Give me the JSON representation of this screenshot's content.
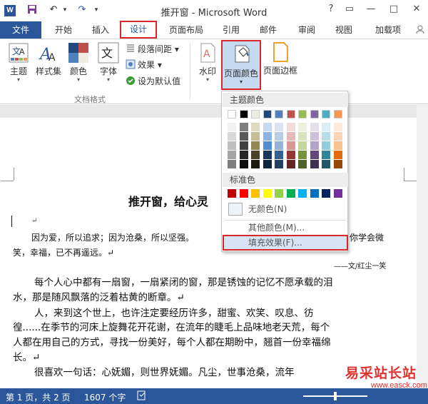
{
  "window": {
    "title": "推开窗 - Microsoft Word",
    "help": "?",
    "minimize": "—",
    "restore": "□",
    "close": "✕",
    "ribbon_toggle": "▭"
  },
  "quick_access": {
    "app_icon": "W",
    "save": "💾",
    "undo": "↶",
    "undo_drop": "▾",
    "redo": "↷",
    "customize": "▾"
  },
  "tabs": {
    "file": "文件",
    "home": "开始",
    "insert": "插入",
    "design": "设计",
    "layout": "页面布局",
    "references": "引用",
    "mailings": "邮件",
    "review": "审阅",
    "view": "视图",
    "addins": "加载项"
  },
  "ribbon": {
    "theme": "主题",
    "style_set": "样式集",
    "colors": "颜色",
    "fonts": "字体",
    "paragraph_spacing": "段落间距",
    "effects": "效果",
    "set_default": "设为默认值",
    "doc_format_group": "文档格式",
    "watermark": "水印",
    "page_color": "页面颜色",
    "page_borders": "页面边框",
    "dropdown_arrow": "▾"
  },
  "page_color_menu": {
    "theme_colors_header": "主题颜色",
    "standard_colors_header": "标准色",
    "no_color": "无颜色(N)",
    "more_colors": "其他颜色(M)...",
    "fill_effects": "填充效果(F)...",
    "theme_top_row": [
      "#ffffff",
      "#000000",
      "#eeece1",
      "#1f497d",
      "#4f81bd",
      "#c0504d",
      "#9bbb59",
      "#8064a2",
      "#4bacc6",
      "#f79646"
    ],
    "theme_shades": [
      [
        "#f2f2f2",
        "#7f7f7f",
        "#ddd9c3",
        "#c6d9f0",
        "#dbe5f1",
        "#f2dcdb",
        "#ebf1dd",
        "#e5e0ec",
        "#dbeef3",
        "#fdeada"
      ],
      [
        "#d8d8d8",
        "#595959",
        "#c4bd97",
        "#8db3e2",
        "#b8cce4",
        "#e5b9b7",
        "#d7e3bc",
        "#ccc1d9",
        "#b7dde8",
        "#fbd5b5"
      ],
      [
        "#bfbfbf",
        "#3f3f3f",
        "#938953",
        "#548dd4",
        "#95b3d7",
        "#d99694",
        "#c3d69b",
        "#b2a2c7",
        "#92cddc",
        "#fac08f"
      ],
      [
        "#a5a5a5",
        "#262626",
        "#494429",
        "#17365d",
        "#366092",
        "#953734",
        "#76923c",
        "#5f497a",
        "#31859b",
        "#e36c09"
      ],
      [
        "#7f7f7f",
        "#0c0c0c",
        "#1d1b10",
        "#0f243e",
        "#244061",
        "#632423",
        "#4f6128",
        "#3f3151",
        "#205867",
        "#974806"
      ]
    ],
    "standard": [
      "#c00000",
      "#ff0000",
      "#ffc000",
      "#ffff00",
      "#92d050",
      "#00b050",
      "#00b0f0",
      "#0070c0",
      "#002060",
      "#7030a0"
    ]
  },
  "document": {
    "title": "推开窗，给心灵",
    "return_mark": "↵",
    "p1_line1": "因为爱，所以追求；因为沧桑，所以坚强。",
    "p1_line1_tail": "你学会微",
    "p1_line2": "笑，幸福，已不再遥远。↵",
    "author": "——文/红尘一笑",
    "p2_line1": "每个人心中都有一扇窗，一扇紧闭的窗，那是锈蚀的记忆不愿承载的泪",
    "p2_line2": "水，那是随风飘落的泛着枯黄的断章。↵",
    "p3_line1": "人，来到这个世上，也许注定要经历许多，甜蜜、欢笑、叹息、彷",
    "p3_line2": "徨......在季节的河床上旋舞花开花谢，在流年的睫毛上品味地老天荒，每个",
    "p3_line3": "人都在用自己的方式，寻找一份美好，每个人都在期盼中，翘首一份幸福绵",
    "p3_line4": "长。↵",
    "p4_line1": "很喜欢一句话：心妩媚，则世界妩媚。凡尘，世事沧桑，流年"
  },
  "status": {
    "page": "第 1 页，共 2 页",
    "words": "1607 个字"
  },
  "watermark": {
    "text": "易采站长站",
    "url": "www.easck.com"
  }
}
